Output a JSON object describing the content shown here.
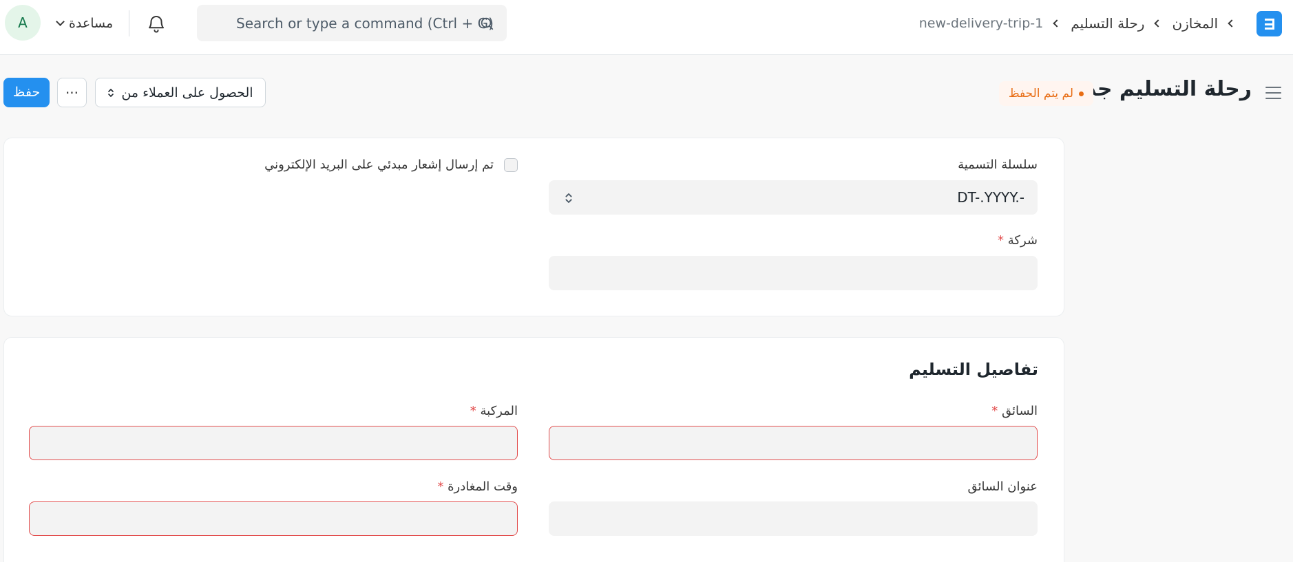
{
  "navbar": {
    "avatar_initial": "A",
    "help_label": "مساعدة",
    "search_placeholder": "Search or type a command (Ctrl + G)",
    "breadcrumb": [
      "المخازن",
      "رحلة التسليم",
      "new-delivery-trip-1"
    ]
  },
  "page_head": {
    "title": "رحلة التسليم جديد",
    "status_badge": "لم يتم الحفظ",
    "save_button": "حفظ",
    "more_button": "···",
    "get_customers_button": "الحصول على العملاء من"
  },
  "form": {
    "naming_series": {
      "label": "سلسلة التسمية",
      "value": "DT-.YYYY.-"
    },
    "company": {
      "label": "شركة",
      "required": "*",
      "value": ""
    },
    "email_notification": {
      "label": "تم إرسال إشعار مبدئي على البريد الإلكتروني",
      "checked": false
    },
    "delivery_details": {
      "title": "تفاصيل التسليم",
      "driver": {
        "label": "السائق",
        "required": "*",
        "value": ""
      },
      "vehicle": {
        "label": "المركبة",
        "required": "*",
        "value": ""
      },
      "driver_address": {
        "label": "عنوان السائق",
        "value": ""
      },
      "departure_time": {
        "label": "وقت المغادرة",
        "required": "*",
        "value": ""
      }
    }
  },
  "colors": {
    "primary": "#2490ef",
    "error": "#e24c4c",
    "badge_text": "#e86c13",
    "badge_bg": "#fff5f0"
  },
  "icons": [
    "search-icon",
    "bell-icon",
    "chevron-down-icon",
    "menu-icon",
    "updown-icon",
    "app-logo"
  ]
}
